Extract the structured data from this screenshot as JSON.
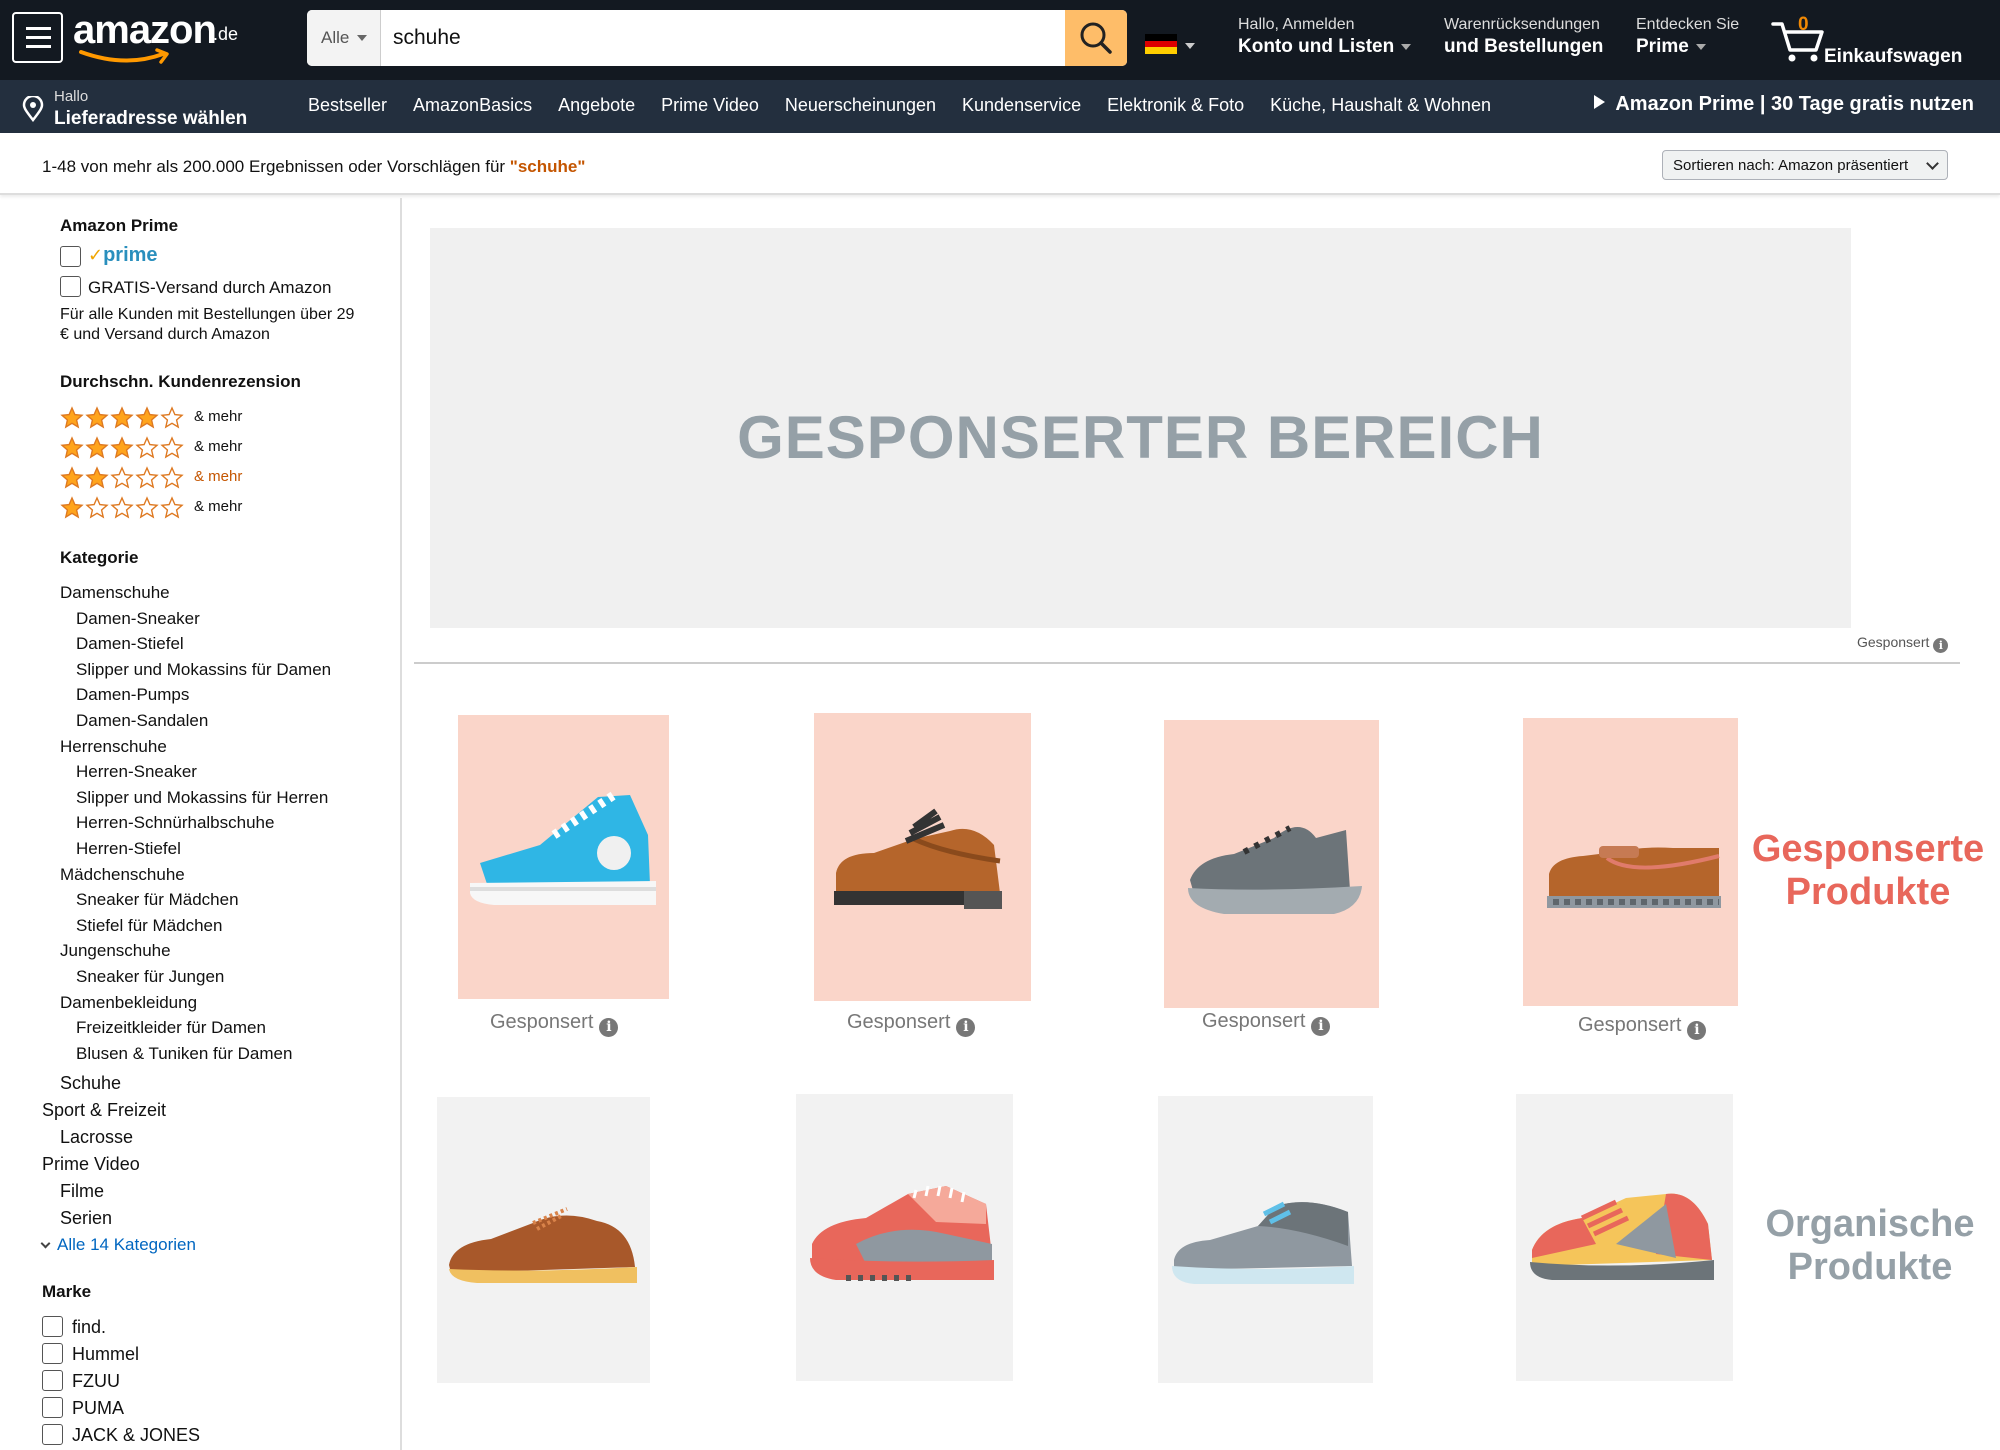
{
  "header": {
    "logo_word": "amazon",
    "logo_tld": ".de",
    "search_category": "Alle",
    "search_value": "schuhe",
    "account_line1": "Hallo, Anmelden",
    "account_line2": "Konto und Listen",
    "orders_line1": "Warenrücksendungen",
    "orders_line2": "und Bestellungen",
    "prime_line1": "Entdecken Sie",
    "prime_line2": "Prime",
    "cart_count": "0",
    "cart_label": "Einkaufswagen"
  },
  "subnav": {
    "deliver_line1": "Hallo",
    "deliver_line2": "Lieferadresse wählen",
    "items": [
      "Bestseller",
      "AmazonBasics",
      "Angebote",
      "Prime Video",
      "Neuerscheinungen",
      "Kundenservice",
      "Elektronik & Foto",
      "Küche, Haushalt & Wohnen"
    ],
    "promo": "Amazon Prime | 30 Tage gratis nutzen"
  },
  "results": {
    "text": "1-48 von mehr als 200.000 Ergebnissen oder Vorschlägen für ",
    "query": "\"schuhe\"",
    "sort_label": "Sortieren nach:  Amazon präsentiert"
  },
  "sidebar": {
    "prime_heading": "Amazon Prime",
    "prime_logo": "prime",
    "free_shipping": "GRATIS-Versand durch Amazon",
    "free_note_1": "Für alle Kunden mit Bestellungen über 29",
    "free_note_2": "€ und Versand durch Amazon",
    "rating_heading": "Durchschn. Kundenrezension",
    "ratings": [
      {
        "stars": 4,
        "label": "& mehr"
      },
      {
        "stars": 3,
        "label": "& mehr"
      },
      {
        "stars": 2,
        "label": "& mehr"
      },
      {
        "stars": 1,
        "label": "& mehr"
      }
    ],
    "category_heading": "Kategorie",
    "categories": [
      "Damenschuhe",
      "Damen-Sneaker",
      "Damen-Stiefel",
      "Slipper und Mokassins für Damen",
      "Damen-Pumps",
      "Damen-Sandalen",
      "Herrenschuhe",
      "Herren-Sneaker",
      "Slipper und Mokassins für Herren",
      "Herren-Schnürhalbschuhe",
      "Herren-Stiefel",
      "Mädchenschuhe",
      "Sneaker für Mädchen",
      "Stiefel für Mädchen",
      "Jungenschuhe",
      "Sneaker für Jungen",
      "Damenbekleidung",
      "Freizeitkleider für Damen",
      "Blusen & Tuniken für Damen"
    ],
    "categories_lower": [
      "Schuhe",
      "Sport & Freizeit",
      "Lacrosse",
      "Prime Video",
      "Filme",
      "Serien"
    ],
    "all_categories": "Alle 14 Kategorien",
    "brand_heading": "Marke",
    "brands": [
      "find.",
      "Hummel",
      "FZUU",
      "PUMA",
      "JACK & JONES"
    ]
  },
  "main": {
    "sponsored_area_title": "GESPONSERTER BEREICH",
    "sponsored_tag": "Gesponsert",
    "sponsored_card_label": "Gesponsert",
    "sponsored_products_label_1": "Gesponserte",
    "sponsored_products_label_2": "Produkte",
    "organic_products_label_1": "Organische",
    "organic_products_label_2": "Produkte",
    "sponsored_products": [
      "high-top-sneaker-icon",
      "derby-shoe-icon",
      "running-shoe-icon",
      "loafer-icon"
    ],
    "organic_products": [
      "brogue-shoe-icon",
      "knit-sneaker-icon",
      "casual-shoe-icon",
      "sport-sneaker-icon"
    ]
  },
  "colors": {
    "nav_dark": "#131921",
    "nav_sub": "#232f3e",
    "search_button": "#febd69",
    "cart_count": "#f08804",
    "query_highlight": "#c45500",
    "sponsored_bg": "#fad5c9",
    "organic_bg": "#f2f2f2",
    "sponsored_label": "#e8675b",
    "organic_label": "#95a0a7",
    "link": "#0066c0"
  }
}
